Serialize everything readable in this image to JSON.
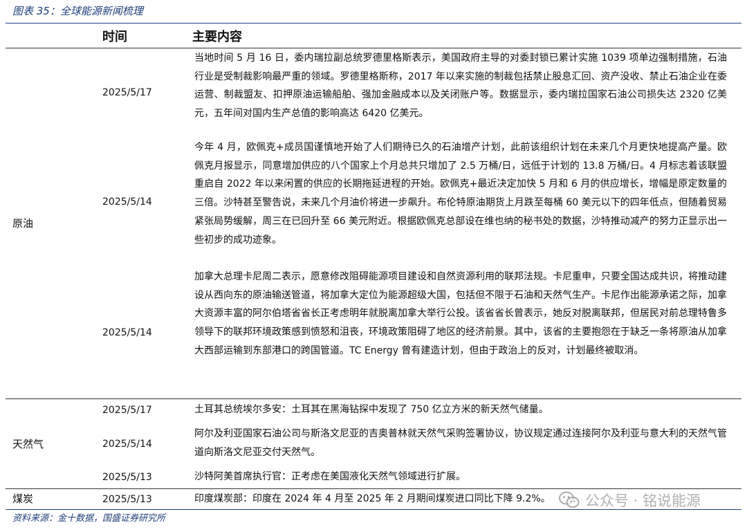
{
  "figure_title": "图表 35：全球能源新闻梳理",
  "columns": {
    "time": "时间",
    "content": "主要内容"
  },
  "sections": [
    {
      "category": "原油",
      "rows": [
        {
          "date": "2025/5/17",
          "text": "当地时间 5 月 16 日，委内瑞拉副总统罗德里格斯表示，美国政府主导的对委封锁已累计实施 1039 项单边强制措施，石油行业是受制裁影响最严重的领域。罗德里格斯称，2017 年以来实施的制裁包括禁止股息汇回、资产没收、禁止石油企业在委运营、制裁盟友、扣押原油运输船舶、强加金融成本以及关闭账户等。数据显示，委内瑞拉国家石油公司损失达 2320 亿美元，五年间对国内生产总值的影响高达 6420 亿美元。"
        },
        {
          "date": "2025/5/14",
          "text": "今年 4 月，欧佩克+成员国谨慎地开始了人们期待已久的石油增产计划，此前该组织计划在未来几个月更快地提高产量。欧佩克月报显示，同意增加供应的八个国家上个月总共只增加了 2.5 万桶/日，远低于计划的 13.8 万桶/日。4 月标志着该联盟重启自 2022 年以来闲置的供应的长期拖延进程的开始。欧佩克+最近决定加快 5 月和 6 月的供应增长，增幅是原定数量的三倍。沙特甚至警告说，未来几个月油价将进一步飙升。布伦特原油期货上月跌至每桶 60 美元以下的四年低点，但随着贸易紧张局势缓解，周三在已回升至 66 美元附近。根据欧佩克总部设在维也纳的秘书处的数据，沙特推动减产的努力正显示出一些初步的成功迹象。"
        },
        {
          "date": "2025/5/14",
          "text": "加拿大总理卡尼周二表示，愿意修改阻碍能源项目建设和自然资源利用的联邦法规。卡尼重申，只要全国达成共识，将推动建设从西向东的原油输送管道，将加拿大定位为能源超级大国，包括但不限于石油和天然气生产。卡尼作出能源承诺之际，加拿大资源丰富的阿尔伯塔省省长正考虑明年就脱离加拿大举行公投。该省省长曾表示，她反对脱离联邦，但居民对前总理特鲁多领导下的联邦环境政策感到愤怒和沮丧，环境政策阻碍了地区的经济前景。其中，该省的主要抱怨在于缺乏一条将原油从加拿大西部运输到东部港口的跨国管道。TC Energy 曾有建造计划，但由于政治上的反对，计划最终被取消。"
        }
      ]
    },
    {
      "category": "天然气",
      "rows": [
        {
          "date": "2025/5/17",
          "text": "土耳其总统埃尔多安：土耳其在黑海钻探中发现了 750 亿立方米的新天然气储量。"
        },
        {
          "date": "2025/5/14",
          "text": "阿尔及利亚国家石油公司与斯洛文尼亚的吉奥普林就天然气采购签署协议，协议规定通过连接阿尔及利亚与意大利的天然气管道向斯洛文尼亚交付天然气。"
        },
        {
          "date": "2025/5/13",
          "text": "沙特阿美首席执行官：正考虑在美国液化天然气领域进行扩展。"
        }
      ]
    },
    {
      "category": "煤炭",
      "rows": [
        {
          "date": "2025/5/13",
          "text": "印度煤炭部：印度在 2024 年 4 月至 2025 年 2 月期间煤炭进口同比下降 9.2%。"
        }
      ]
    }
  ],
  "source": "资料来源：金十数据，国盛证券研究所",
  "watermark": {
    "icon": "wechat-icon",
    "text": "公众号 · 铭说能源"
  },
  "colors": {
    "accent": "#1f3f7a",
    "text": "#111111"
  }
}
